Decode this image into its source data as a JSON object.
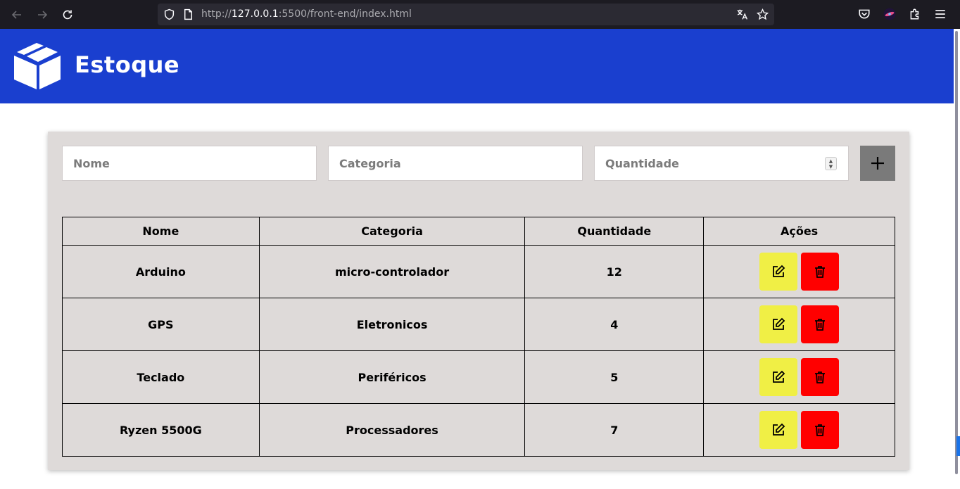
{
  "browser": {
    "url_prefix": "http://",
    "url_host": "127.0.0.1",
    "url_rest": ":5500/front-end/index.html"
  },
  "header": {
    "title": "Estoque",
    "logo_icon": "box-open-icon",
    "background": "#1a3fcf"
  },
  "form": {
    "nome_placeholder": "Nome",
    "categoria_placeholder": "Categoria",
    "quantidade_placeholder": "Quantidade",
    "add_icon": "plus-icon"
  },
  "table": {
    "headers": [
      "Nome",
      "Categoria",
      "Quantidade",
      "Ações"
    ],
    "rows": [
      {
        "nome": "Arduino",
        "categoria": "micro-controlador",
        "quantidade": "12"
      },
      {
        "nome": "GPS",
        "categoria": "Eletronicos",
        "quantidade": "4"
      },
      {
        "nome": "Teclado",
        "categoria": "Periféricos",
        "quantidade": "5"
      },
      {
        "nome": "Ryzen 5500G",
        "categoria": "Processadores",
        "quantidade": "7"
      }
    ],
    "edit_icon": "edit-icon",
    "delete_icon": "trash-icon"
  },
  "colors": {
    "edit_button": "#f0ef45",
    "delete_button": "#ff0000",
    "add_button": "#7a7a7a",
    "card": "#dedad9"
  }
}
